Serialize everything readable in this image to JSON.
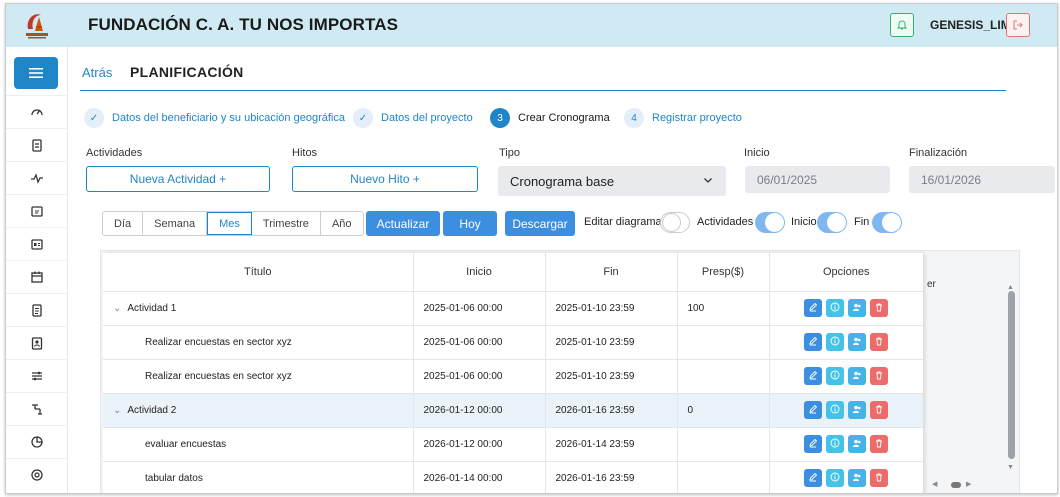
{
  "header": {
    "org_name": "FUNDACIÓN C. A. TU NOS IMPORTAS",
    "user_name": "GENESIS_LIM"
  },
  "colors": {
    "header_bg": "#cfeaf3",
    "primary": "#1f86c7",
    "button": "#3b8ee0",
    "danger": "#ee6b6b",
    "success": "#2bb573"
  },
  "sidebar": {
    "items": [
      "dashboard-icon",
      "clipboard-icon",
      "activity-icon",
      "folder-icon",
      "id-card-icon",
      "calendar-icon",
      "document-icon",
      "contact-icon",
      "sliders-icon",
      "network-icon",
      "pie-chart-icon",
      "settings-icon"
    ]
  },
  "page": {
    "back": "Atrás",
    "title": "PLANIFICACIÓN"
  },
  "steps": [
    {
      "label": "Datos del beneficiario y su ubicación geográfica",
      "state": "done",
      "num": "✓"
    },
    {
      "label": "Datos del proyecto",
      "state": "done",
      "num": "✓"
    },
    {
      "label": "Crear Cronograma",
      "state": "active",
      "num": "3"
    },
    {
      "label": "Registrar proyecto",
      "state": "todo",
      "num": "4"
    }
  ],
  "form": {
    "actividades_label": "Actividades",
    "hitos_label": "Hitos",
    "tipo_label": "Tipo",
    "inicio_label": "Inicio",
    "fin_label": "Finalización",
    "nueva_actividad": "Nueva Actividad  +",
    "nuevo_hito": "Nuevo Hito  +",
    "tipo_value": "Cronograma base",
    "inicio_value": "06/01/2025",
    "fin_value": "16/01/2026"
  },
  "toolbar": {
    "views": [
      "Día",
      "Semana",
      "Mes",
      "Trimestre",
      "Año"
    ],
    "active_view": "Mes",
    "actualizar": "Actualizar",
    "hoy": "Hoy",
    "descargar": "Descargar",
    "editar_label": "Editar diagrama",
    "actividades_label": "Actividades",
    "inicio_label": "Inicio",
    "fin_label": "Fin",
    "toggles": {
      "editar": false,
      "actividades": true,
      "inicio": true,
      "fin": true
    }
  },
  "table": {
    "columns": [
      "Título",
      "Inicio",
      "Fin",
      "Presp($)",
      "Opciones"
    ],
    "gantt_fragment": "er",
    "rows": [
      {
        "titulo": "Actividad 1",
        "inicio": "2025-01-06 00:00",
        "fin": "2025-01-10 23:59",
        "presp": "100",
        "group": true,
        "highlight": false
      },
      {
        "titulo": "Realizar encuestas en sector xyz",
        "inicio": "2025-01-06 00:00",
        "fin": "2025-01-10 23:59",
        "presp": "",
        "group": false,
        "highlight": false
      },
      {
        "titulo": "Realizar encuestas en sector xyz",
        "inicio": "2025-01-06 00:00",
        "fin": "2025-01-10 23:59",
        "presp": "",
        "group": false,
        "highlight": false
      },
      {
        "titulo": "Actividad 2",
        "inicio": "2026-01-12 00:00",
        "fin": "2026-01-16 23:59",
        "presp": "0",
        "group": true,
        "highlight": true
      },
      {
        "titulo": "evaluar encuestas",
        "inicio": "2026-01-12 00:00",
        "fin": "2026-01-14 23:59",
        "presp": "",
        "group": false,
        "highlight": false
      },
      {
        "titulo": "tabular datos",
        "inicio": "2026-01-14 00:00",
        "fin": "2026-01-16 23:59",
        "presp": "",
        "group": false,
        "highlight": false
      }
    ]
  }
}
